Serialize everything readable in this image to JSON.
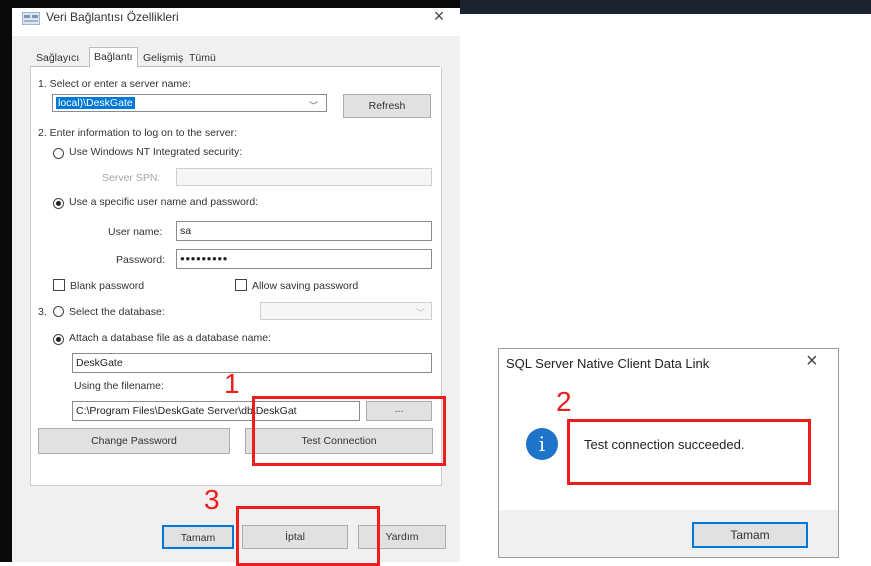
{
  "dialog": {
    "title": "Veri Bağlantısı Özellikleri",
    "close": "×",
    "tabs": [
      "Sağlayıcı",
      "Bağlantı",
      "Gelişmiş",
      "Tümü"
    ],
    "step1": "1. Select or enter a server name:",
    "server_name": "local)\\DeskGate",
    "refresh": "Refresh",
    "step2": "2. Enter information to log on to the server:",
    "use_nt": "Use Windows NT Integrated security:",
    "server_spn": "Server SPN:",
    "use_specific": "Use a specific user name and password:",
    "user_name_label": "User name:",
    "user_name": "sa",
    "password_label": "Password:",
    "password": "●●●●●●●●●",
    "blank_password": "Blank password",
    "allow_saving": "Allow saving password",
    "step3": "3.",
    "select_db": "Select the database:",
    "attach_db": "Attach a database file as a database name:",
    "db_name": "DeskGate",
    "using_filename": "Using the filename:",
    "filename": "C:\\Program Files\\DeskGate Server\\db\\DeskGat",
    "browse": "...",
    "change_password": "Change Password",
    "test_connection": "Test Connection",
    "ok": "Tamam",
    "cancel": "İptal",
    "help": "Yardım"
  },
  "popup": {
    "title": "SQL Server Native Client Data Link",
    "close": "×",
    "icon": "info-icon",
    "message": "Test connection succeeded.",
    "ok": "Tamam"
  },
  "annotations": {
    "one": "1",
    "two": "2",
    "three": "3",
    "color": "#ee1c1c"
  }
}
